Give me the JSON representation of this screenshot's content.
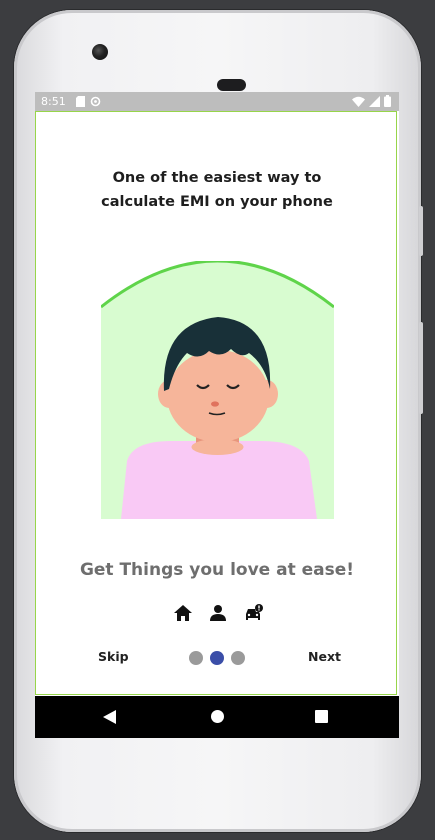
{
  "status_bar": {
    "time": "8:51",
    "left_icons": [
      "sd-card-icon",
      "sync-icon"
    ],
    "right_icons": [
      "wifi-icon",
      "signal-icon",
      "battery-icon"
    ]
  },
  "onboarding": {
    "title": "One of the easiest way to\ncalculate EMI on your phone",
    "subtitle": "Get Things you love at ease!",
    "feature_icons": [
      "home-icon",
      "person-icon",
      "car-alert-icon"
    ],
    "skip_label": "Skip",
    "next_label": "Next",
    "page_count": 3,
    "current_page": 2
  },
  "navigation_bar": {
    "buttons": [
      "back-icon",
      "home-circle-icon",
      "recents-icon"
    ]
  },
  "colors": {
    "accent_dot": "#3b4ea8",
    "inactive_dot": "#9a9a9a",
    "illustration_bg": "#d8fcd0",
    "arc": "#5fd44a",
    "shirt": "#f9c9f5",
    "skin": "#f6b59a",
    "hair": "#183038",
    "content_border": "#97d54a"
  }
}
